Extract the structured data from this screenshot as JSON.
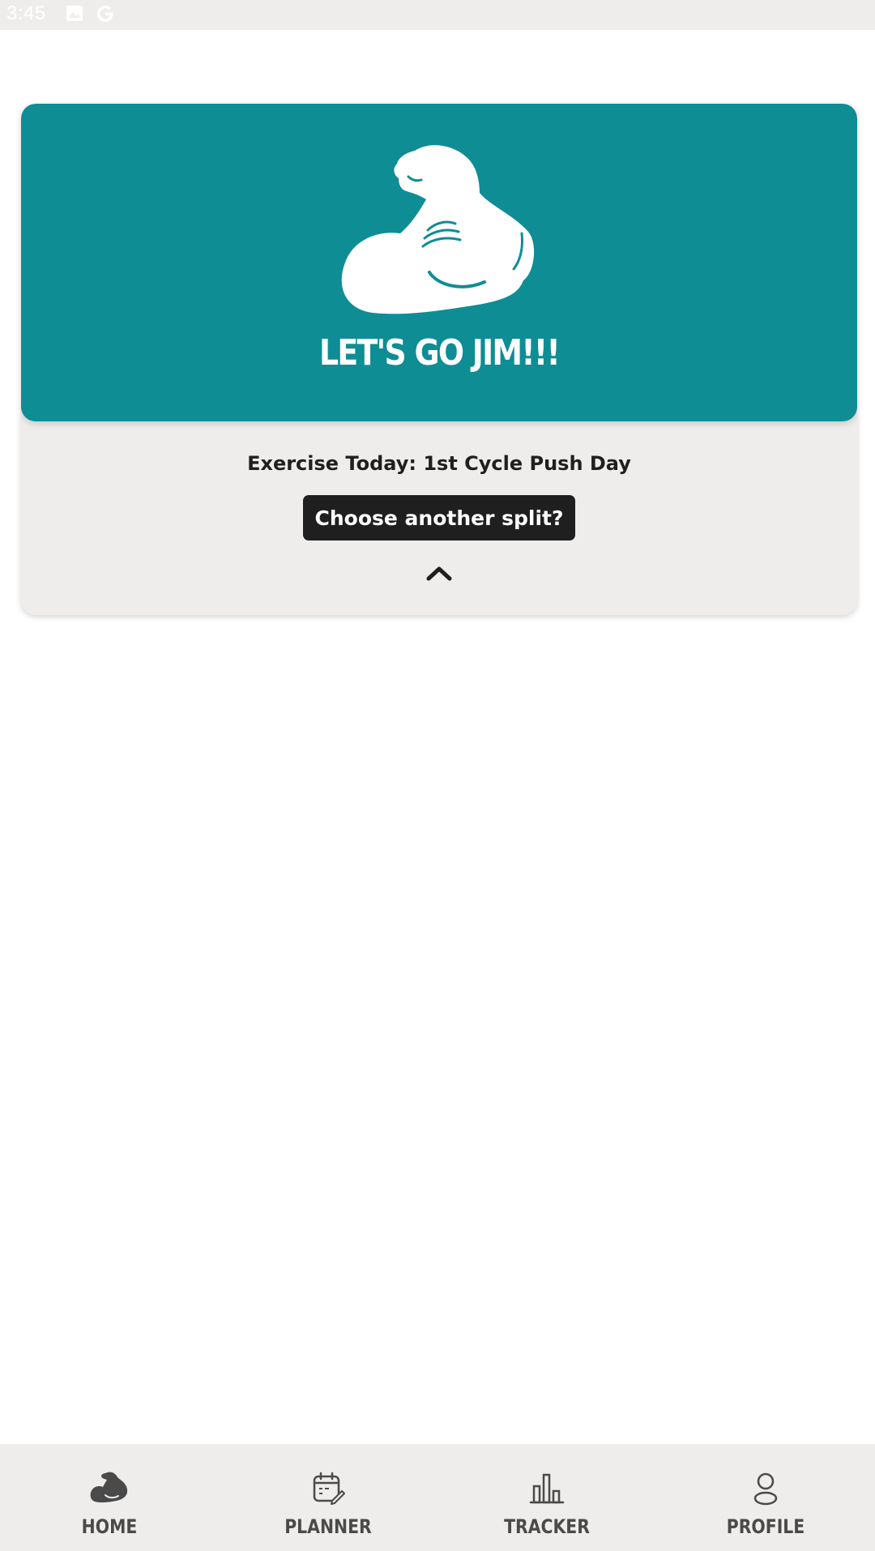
{
  "status_bar": {
    "time": "3:45"
  },
  "hero": {
    "title": "LET'S GO JIM!!!",
    "icon": "flexed-arm-icon",
    "background_color": "#0e8d95"
  },
  "workout": {
    "exercise_today": "Exercise Today: 1st Cycle Push Day",
    "choose_split_label": "Choose another split?"
  },
  "bottom_nav": {
    "items": [
      {
        "label": "HOME",
        "icon": "flexed-arm-icon"
      },
      {
        "label": "PLANNER",
        "icon": "calendar-edit-icon"
      },
      {
        "label": "TRACKER",
        "icon": "bar-chart-icon"
      },
      {
        "label": "PROFILE",
        "icon": "user-icon"
      }
    ]
  }
}
